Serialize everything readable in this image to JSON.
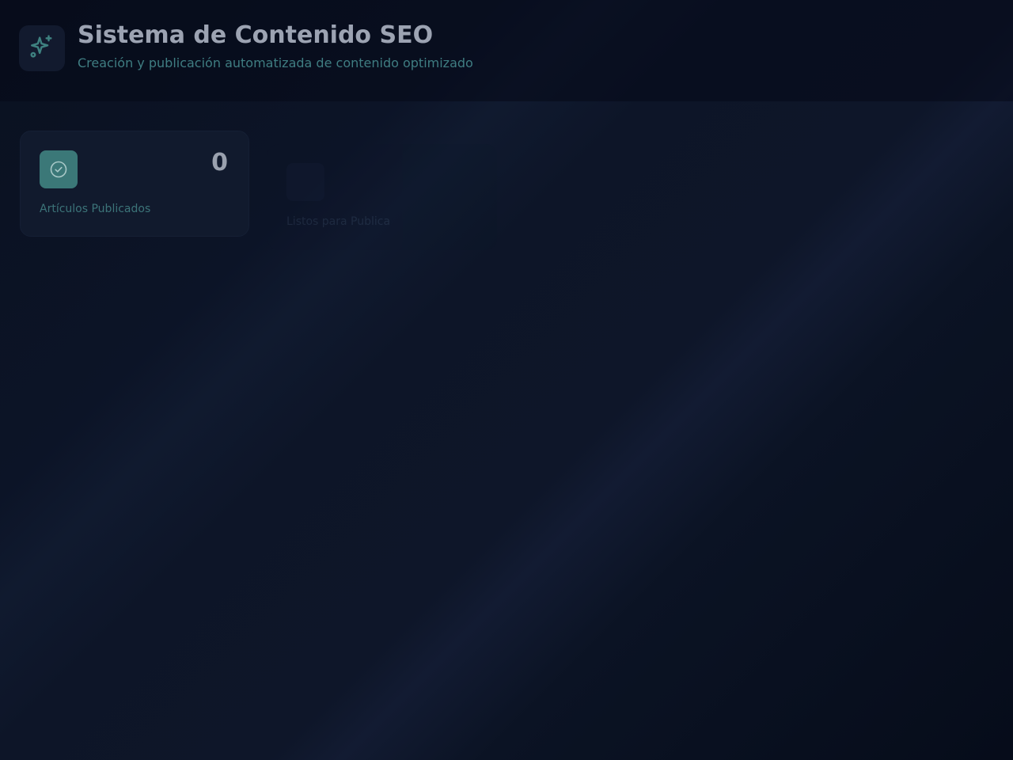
{
  "header": {
    "title": "Sistema de Contenido SEO",
    "subtitle": "Creación y publicación automatizada de contenido optimizado",
    "logo_icon": "sparkles-icon"
  },
  "stats": [
    {
      "icon": "check-circle-icon",
      "value": "0",
      "label": "Artículos Publicados"
    },
    {
      "icon": "clock-icon",
      "value": "",
      "label": "Listos para Publicar"
    }
  ],
  "colors": {
    "accent_teal": "#3b7878",
    "subtitle_teal": "#3f7d82",
    "background_dark": "#0c1427",
    "card_bg": "#111a2d"
  }
}
